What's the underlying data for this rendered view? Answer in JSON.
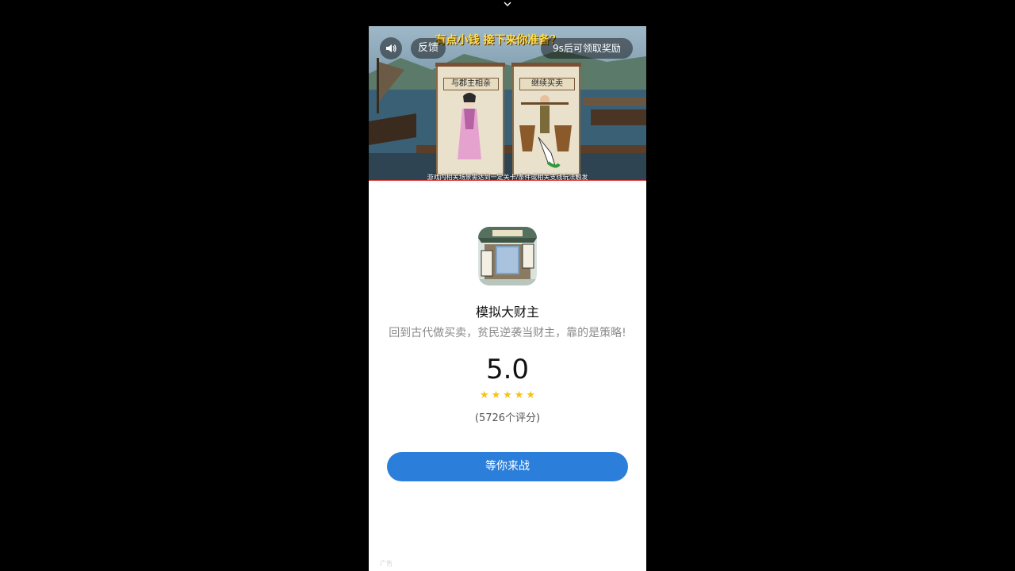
{
  "video": {
    "title": "有点小钱 接下来你准备？",
    "feedback_label": "反馈",
    "reward_text": "9s后可领取奖励",
    "disclaimer": "游戏内相关场景需达到一定关卡/条件或相关支线玩法触发",
    "option_left": "与郡主相亲",
    "option_right": "继续买卖",
    "progress": 1.0,
    "sound_icon": "speaker-icon"
  },
  "app": {
    "name": "模拟大财主",
    "description": "回到古代做买卖，贫民逆袭当财主，靠的是策略!",
    "rating": "5.0",
    "stars": 5,
    "review_count": "(5726个评分)",
    "cta_label": "等你来战",
    "ad_label": "广告"
  },
  "colors": {
    "accent": "#2b7fda",
    "star": "#f4c21a",
    "progress": "#e33b3b"
  }
}
